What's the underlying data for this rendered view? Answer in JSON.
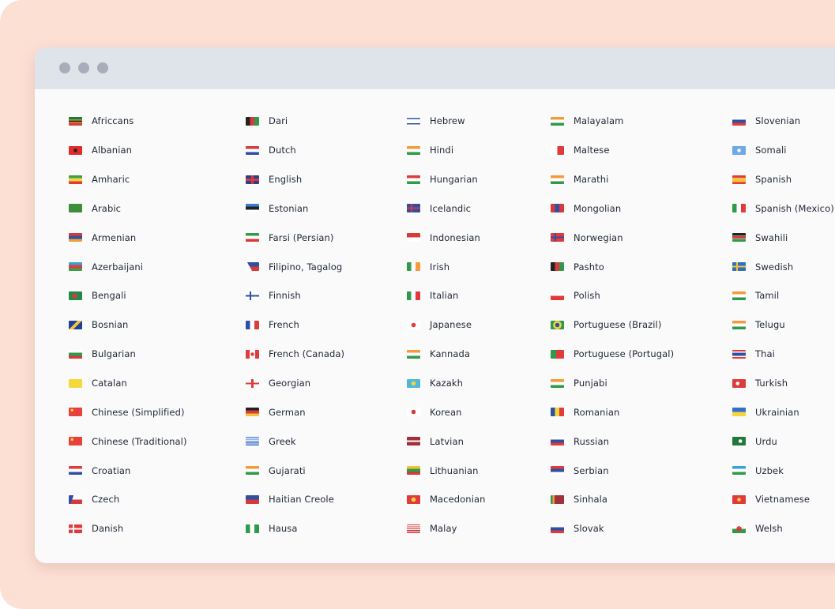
{
  "window": {
    "controls": [
      "close",
      "minimize",
      "maximize"
    ]
  },
  "columns": [
    [
      {
        "label": "Africcans",
        "flag": "linear-gradient(#1d7a3a 0 33%, #f5c33b 33% 40%, #222 40% 60%, #f5c33b 60% 67%, #d63a3a 67%)"
      },
      {
        "label": "Albanian",
        "flag": "radial-gradient(circle at 50% 50%, #222 0 2px, #e02b2b 2.5px)"
      },
      {
        "label": "Amharic",
        "flag": "linear-gradient(#3aa04a 0 33%, #f5d53b 33% 66%, #e03b3b 66%)"
      },
      {
        "label": "Arabic",
        "flag": "linear-gradient(#3f8e3a, #3f8e3a)"
      },
      {
        "label": "Armenian",
        "flag": "linear-gradient(#d23b3b 0 33%, #2e4fa3 33% 66%, #f0a030 66%)"
      },
      {
        "label": "Azerbaijani",
        "flag": "linear-gradient(#3aa0d8 0 33%, #e23b3b 33% 66%, #3aa04a 66%)"
      },
      {
        "label": "Bengali",
        "flag": "radial-gradient(circle at 45% 50%, #d63a3a 0 3px, #1f8a4a 3.5px)"
      },
      {
        "label": "Bosnian",
        "flag": "linear-gradient(135deg, #1f3f9a 0 40%, #f5c33b 40% 60%, #1f3f9a 60%)"
      },
      {
        "label": "Bulgarian",
        "flag": "linear-gradient(#ffffff 0 33%, #2e9a4a 33% 66%, #d63a3a 66%)"
      },
      {
        "label": "Catalan",
        "flag": "linear-gradient(#f7d83b, #f7d83b)"
      },
      {
        "label": "Chinese (Simplified)",
        "flag": "radial-gradient(circle at 25% 30%, #f5d53b 0 1.5px, #e8403a 2px)"
      },
      {
        "label": "Chinese (Traditional)",
        "flag": "radial-gradient(circle at 25% 30%, #f5d53b 0 1.5px, #e8403a 2px)"
      },
      {
        "label": "Croatian",
        "flag": "linear-gradient(#e03b3b 0 33%, #ffffff 33% 66%, #2e4fa3 66%)"
      },
      {
        "label": "Czech",
        "flag": "linear-gradient(110deg, #2e4fa3 0 30%, transparent 30%), linear-gradient(#ffffff 0 50%, #d63a3a 50%)"
      },
      {
        "label": "Danish",
        "flag": "linear-gradient(90deg, transparent 0 30%, #fff 30% 42%, transparent 42%), linear-gradient(transparent 0 42%, #fff 42% 58%, transparent 58%), linear-gradient(#e03b3b, #e03b3b)"
      }
    ],
    [
      {
        "label": "Dari",
        "flag": "linear-gradient(90deg, #222 0 33%, #d63a3a 33% 66%, #2e9a4a 66%)"
      },
      {
        "label": "Dutch",
        "flag": "linear-gradient(#d63a3a 0 33%, #ffffff 33% 66%, #2e4fa3 66%)"
      },
      {
        "label": "English",
        "flag": "linear-gradient(90deg, transparent 0 42%, #d63a3a 42% 58%, transparent 58%), linear-gradient(transparent 0 38%, #d63a3a 38% 62%, transparent 62%), linear-gradient(#2b3f8c, #2b3f8c)"
      },
      {
        "label": "Estonian",
        "flag": "linear-gradient(#3a7fcf 0 33%, #222 33% 66%, #ffffff 66%)"
      },
      {
        "label": "Farsi (Persian)",
        "flag": "linear-gradient(#2e9a4a 0 33%, #ffffff 33% 66%, #d63a3a 66%)"
      },
      {
        "label": "Filipino, Tagalog",
        "flag": "linear-gradient(60deg, #ffffff 0 35%, transparent 35%), linear-gradient(#2e4fa3 0 50%, #d63a3a 50%)"
      },
      {
        "label": "Finnish",
        "flag": "linear-gradient(90deg, transparent 0 30%, #2e4fa3 30% 42%, transparent 42%), linear-gradient(transparent 0 40%, #2e4fa3 40% 60%, transparent 60%), linear-gradient(#ffffff, #ffffff)"
      },
      {
        "label": "French",
        "flag": "linear-gradient(90deg, #2e4fa3 0 33%, #ffffff 33% 66%, #e03b3b 66%)"
      },
      {
        "label": "French (Canada)",
        "flag": "radial-gradient(circle at 50% 50%, #e03b3b 0 2px, transparent 2.5px), linear-gradient(90deg, #e03b3b 0 28%, #ffffff 28% 72%, #e03b3b 72%)"
      },
      {
        "label": "Georgian",
        "flag": "linear-gradient(90deg, transparent 0 42%, #e03b3b 42% 58%, transparent 58%), linear-gradient(transparent 0 40%, #e03b3b 40% 60%, transparent 60%), linear-gradient(#ffffff, #ffffff)"
      },
      {
        "label": "German",
        "flag": "linear-gradient(#222 0 33%, #d63a3a 33% 66%, #f5c33b 66%)"
      },
      {
        "label": "Greek",
        "flag": "repeating-linear-gradient(#3a6fc8 0 1.2px, #ffffff 1.2px 2.4px)"
      },
      {
        "label": "Gujarati",
        "flag": "linear-gradient(#f59a3b 0 33%, #ffffff 33% 66%, #2e9a4a 66%)"
      },
      {
        "label": "Haitian Creole",
        "flag": "linear-gradient(#2e4fa3 0 50%, #d63a3a 50%)"
      },
      {
        "label": "Hausa",
        "flag": "linear-gradient(90deg, #2e9a4a 0 33%, #ffffff 33% 66%, #2e9a4a 66%)"
      }
    ],
    [
      {
        "label": "Hebrew",
        "flag": "linear-gradient(#ffffff 0 15%, #2e4fa3 15% 28%, #ffffff 28% 72%, #2e4fa3 72% 85%, #ffffff 85%)"
      },
      {
        "label": "Hindi",
        "flag": "linear-gradient(#f59a3b 0 33%, #ffffff 33% 66%, #2e9a4a 66%)"
      },
      {
        "label": "Hungarian",
        "flag": "linear-gradient(#e03b3b 0 33%, #ffffff 33% 66%, #2e9a4a 66%)"
      },
      {
        "label": "Icelandic",
        "flag": "linear-gradient(90deg, transparent 0 30%, #d63a3a 30% 42%, transparent 42%), linear-gradient(transparent 0 40%, #d63a3a 40% 60%, transparent 60%), linear-gradient(#2e4fa3, #2e4fa3)"
      },
      {
        "label": "Indonesian",
        "flag": "linear-gradient(#d63a3a 0 50%, #ffffff 50%)"
      },
      {
        "label": "Irish",
        "flag": "linear-gradient(90deg, #2e9a4a 0 33%, #ffffff 33% 66%, #f59a3b 66%)"
      },
      {
        "label": "Italian",
        "flag": "linear-gradient(90deg, #2e9a4a 0 33%, #ffffff 33% 66%, #e03b3b 66%)"
      },
      {
        "label": "Japanese",
        "flag": "radial-gradient(circle at 50% 50%, #e03b3b 0 2.5px, #ffffff 3px)"
      },
      {
        "label": "Kannada",
        "flag": "linear-gradient(#f59a3b 0 33%, #ffffff 33% 66%, #2e9a4a 66%)"
      },
      {
        "label": "Kazakh",
        "flag": "radial-gradient(circle at 50% 50%, #f5d53b 0 2.5px, #4fb8d8 3px)"
      },
      {
        "label": "Korean",
        "flag": "radial-gradient(circle at 50% 50%, #d63a3a 0 2.5px, #ffffff 3px)"
      },
      {
        "label": "Latvian",
        "flag": "linear-gradient(#a0303a 0 40%, #ffffff 40% 60%, #a0303a 60%)"
      },
      {
        "label": "Lithuanian",
        "flag": "linear-gradient(#f5c33b 0 33%, #2e9a4a 33% 66%, #d63a3a 66%)"
      },
      {
        "label": "Macedonian",
        "flag": "radial-gradient(circle at 50% 50%, #f5d53b 0 2.5px, #e03b3b 3px)"
      },
      {
        "label": "Malay",
        "flag": "repeating-linear-gradient(#d63a3a 0 1.2px, #ffffff 1.2px 2.4px)"
      }
    ],
    [
      {
        "label": "Malayalam",
        "flag": "linear-gradient(#f59a3b 0 33%, #ffffff 33% 66%, #2e9a4a 66%)"
      },
      {
        "label": "Maltese",
        "flag": "linear-gradient(90deg, #ffffff 0 50%, #e03b3b 50%)"
      },
      {
        "label": "Marathi",
        "flag": "linear-gradient(#f59a3b 0 33%, #ffffff 33% 66%, #2e9a4a 66%)"
      },
      {
        "label": "Mongolian",
        "flag": "linear-gradient(90deg, #d63a3a 0 33%, #2e4fa3 33% 66%, #d63a3a 66%)"
      },
      {
        "label": "Norwegian",
        "flag": "linear-gradient(90deg, transparent 0 30%, #2e4fa3 30% 42%, transparent 42%), linear-gradient(transparent 0 40%, #2e4fa3 40% 60%, transparent 60%), linear-gradient(#e03b3b, #e03b3b)"
      },
      {
        "label": "Pashto",
        "flag": "linear-gradient(90deg, #222 0 33%, #d63a3a 33% 66%, #2e9a4a 66%)"
      },
      {
        "label": "Polish",
        "flag": "linear-gradient(#ffffff 0 50%, #e03b3b 50%)"
      },
      {
        "label": "Portuguese (Brazil)",
        "flag": "radial-gradient(circle at 50% 50%, #2e4fa3 0 2.5px, #f5d53b 3px 5px, #2e9a4a 5.5px)"
      },
      {
        "label": "Portuguese (Portugal)",
        "flag": "linear-gradient(90deg, #2e9a4a 0 40%, #e03b3b 40%)"
      },
      {
        "label": "Punjabi",
        "flag": "linear-gradient(#f59a3b 0 33%, #ffffff 33% 66%, #2e9a4a 66%)"
      },
      {
        "label": "Romanian",
        "flag": "linear-gradient(90deg, #2e4fa3 0 33%, #f5d53b 33% 66%, #e03b3b 66%)"
      },
      {
        "label": "Russian",
        "flag": "linear-gradient(#ffffff 0 33%, #2e4fa3 33% 66%, #e03b3b 66%)"
      },
      {
        "label": "Serbian",
        "flag": "linear-gradient(#e03b3b 0 33%, #2e4fa3 33% 66%, #ffffff 66%)"
      },
      {
        "label": "Sinhala",
        "flag": "linear-gradient(90deg, #2e9a4a 0 15%, #f59a3b 15% 30%, #a0303a 30%)"
      },
      {
        "label": "Slovak",
        "flag": "linear-gradient(#ffffff 0 33%, #2e4fa3 33% 66%, #e03b3b 66%)"
      }
    ],
    [
      {
        "label": "Slovenian",
        "flag": "linear-gradient(#ffffff 0 33%, #2e4fa3 33% 66%, #e03b3b 66%)"
      },
      {
        "label": "Somali",
        "flag": "radial-gradient(circle at 50% 50%, #ffffff 0 2px, #6fa8e8 2.5px)"
      },
      {
        "label": "Spanish",
        "flag": "linear-gradient(#e03b3b 0 25%, #f5c33b 25% 75%, #e03b3b 75%)"
      },
      {
        "label": "Spanish (Mexico)",
        "flag": "linear-gradient(90deg, #2e9a4a 0 33%, #ffffff 33% 66%, #e03b3b 66%)"
      },
      {
        "label": "Swahili",
        "flag": "linear-gradient(#222 0 30%, #ffffff 30% 36%, #d63a3a 36% 64%, #ffffff 64% 70%, #2e9a4a 70%)"
      },
      {
        "label": "Swedish",
        "flag": "linear-gradient(90deg, transparent 0 30%, #f5c33b 30% 42%, transparent 42%), linear-gradient(transparent 0 40%, #f5c33b 40% 60%, transparent 60%), linear-gradient(#2e6fbf, #2e6fbf)"
      },
      {
        "label": "Tamil",
        "flag": "linear-gradient(#f59a3b 0 33%, #ffffff 33% 66%, #2e9a4a 66%)"
      },
      {
        "label": "Telugu",
        "flag": "linear-gradient(#f59a3b 0 33%, #ffffff 33% 66%, #2e9a4a 66%)"
      },
      {
        "label": "Thai",
        "flag": "linear-gradient(#e03b3b 0 16%, #ffffff 16% 33%, #2e4fa3 33% 66%, #ffffff 66% 83%, #e03b3b 83%)"
      },
      {
        "label": "Turkish",
        "flag": "radial-gradient(circle at 40% 50%, #ffffff 0 2px, #e03b3b 2.5px)"
      },
      {
        "label": "Ukrainian",
        "flag": "linear-gradient(#2e6fcf 0 50%, #f5d53b 50%)"
      },
      {
        "label": "Urdu",
        "flag": "radial-gradient(circle at 60% 50%, #ffffff 0 2px, #1f7a3a 2.5px)"
      },
      {
        "label": "Uzbek",
        "flag": "linear-gradient(#3aa0d8 0 33%, #ffffff 33% 66%, #2e9a4a 66%)"
      },
      {
        "label": "Vietnamese",
        "flag": "radial-gradient(circle at 50% 50%, #f5d53b 0 2px, #e03b3b 2.5px)"
      },
      {
        "label": "Welsh",
        "flag": "radial-gradient(circle at 50% 50%, #d63a3a 0 3px, transparent 3.5px), linear-gradient(#ffffff 0 50%, #2e9a4a 50%)"
      }
    ]
  ]
}
